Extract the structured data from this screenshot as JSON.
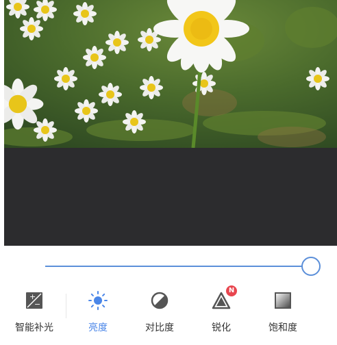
{
  "photo": {
    "description_icon": "daisy-photo"
  },
  "slider": {
    "value_fraction": 0.99,
    "accent_color": "#5b8fd9"
  },
  "tools": [
    {
      "label": "智能补光",
      "icon": "auto-fill-light-icon",
      "active": false
    },
    {
      "label": "亮度",
      "icon": "brightness-icon",
      "active": true
    },
    {
      "label": "对比度",
      "icon": "contrast-icon",
      "active": false
    },
    {
      "label": "锐化",
      "icon": "sharpen-icon",
      "active": false,
      "badge": "N"
    },
    {
      "label": "饱和度",
      "icon": "saturation-icon",
      "active": false
    }
  ],
  "colors": {
    "active": "#4a86e8",
    "badge": "#e8464f",
    "dark_canvas": "#2c2c2e"
  }
}
